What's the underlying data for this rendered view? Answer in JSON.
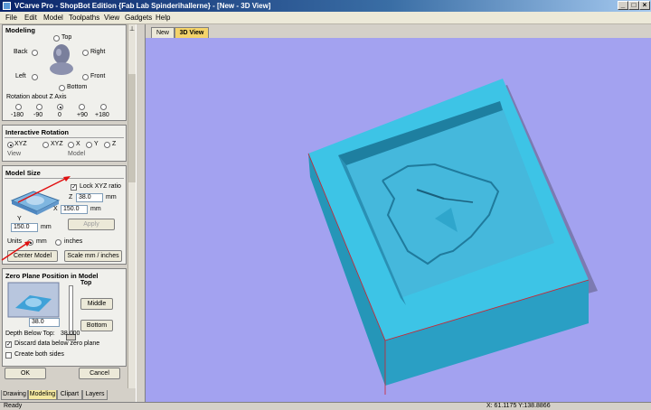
{
  "window": {
    "title": "VCarve Pro - ShopBot Edition {Fab Lab Spinderihallerne} - [New - 3D View]"
  },
  "menu": [
    "File",
    "Edit",
    "Model",
    "Toolpaths",
    "View",
    "Gadgets",
    "Help"
  ],
  "pin_icon": "pin-icon",
  "modeling": {
    "header": "Modeling",
    "views": {
      "top": "Top",
      "back": "Back",
      "right": "Right",
      "left": "Left",
      "front": "Front",
      "bottom": "Bottom"
    },
    "rotation_label": "Rotation about Z Axis",
    "rotation_values": [
      "-180",
      "-90",
      "0",
      "+90",
      "+180"
    ]
  },
  "interactive_rotation": {
    "header": "Interactive Rotation",
    "options": [
      "XYZ",
      "XYZ",
      "X",
      "Y",
      "Z"
    ],
    "group_view": "View",
    "group_model": "Model"
  },
  "model_size": {
    "header": "Model Size",
    "lock_label": "Lock XYZ ratio",
    "z_label": "Z",
    "z_value": "38.0",
    "z_unit": "mm",
    "x_label": "X",
    "x_value": "150.0",
    "x_unit": "mm",
    "y_label": "Y",
    "y_value": "150.0",
    "y_unit": "mm",
    "apply_label": "Apply",
    "units_label": "Units",
    "unit_mm": "mm",
    "unit_inches": "inches",
    "center_button": "Center Model",
    "scale_button": "Scale mm / inches"
  },
  "zero_plane": {
    "header": "Zero Plane Position in Model",
    "top_label": "Top",
    "middle_button": "Middle",
    "bottom_button": "Bottom",
    "value": "38.0",
    "depth_label": "Depth Below Top:",
    "depth_value": "38.000",
    "discard_label": "Discard data below zero plane",
    "both_sides_label": "Create both sides"
  },
  "dialog": {
    "ok": "OK",
    "cancel": "Cancel"
  },
  "bottom_tabs": [
    "Drawing",
    "Modeling",
    "Clipart",
    "Layers"
  ],
  "doc_tabs": [
    "New",
    "3D View"
  ],
  "status": {
    "left": "Ready",
    "coords": "X: 61.1175 Y:138.8866"
  },
  "colors": {
    "model": "#3db4d6",
    "viewport": "#a3a2f0",
    "tab_active": "#f4d36a"
  }
}
